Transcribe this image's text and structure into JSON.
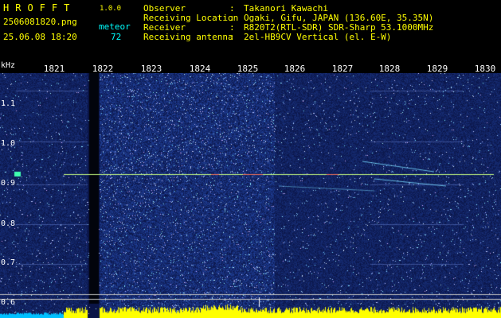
{
  "header": {
    "brand": "HROFFT",
    "version": "1.0.0",
    "filename": "2506081820.png",
    "datetime": "25.06.08 18:20",
    "meteor_label": "meteor",
    "meteor_count": "72",
    "info": [
      {
        "key": "Observer",
        "value": "Takanori Kawachi"
      },
      {
        "key": "Receiving Location",
        "value": "Ogaki, Gifu, JAPAN (136.60E, 35.35N)"
      },
      {
        "key": "Receiver",
        "value": "R820T2(RTL-SDR) SDR-Sharp 53.1000MHz"
      },
      {
        "key": "Receiving antenna",
        "value": "2el-HB9CV Vertical (el. E-W)"
      }
    ]
  },
  "axis": {
    "unit_label": "kHz",
    "time_ticks": [
      "1821",
      "1822",
      "1823",
      "1824",
      "1825",
      "1826",
      "1827",
      "1828",
      "1829",
      "1830"
    ],
    "freq_ticks": [
      "1.1",
      "1.0",
      "0.9",
      "0.8",
      "0.7",
      "0.6"
    ]
  },
  "colors": {
    "header_yellow": "#ffff00",
    "header_cyan": "#00ffff",
    "background": "#000000",
    "waterfall_base": "#0a1a60",
    "signal_line": "#ffff66",
    "level_bar": "#ffff00",
    "level_low": "#00c0ff"
  }
}
